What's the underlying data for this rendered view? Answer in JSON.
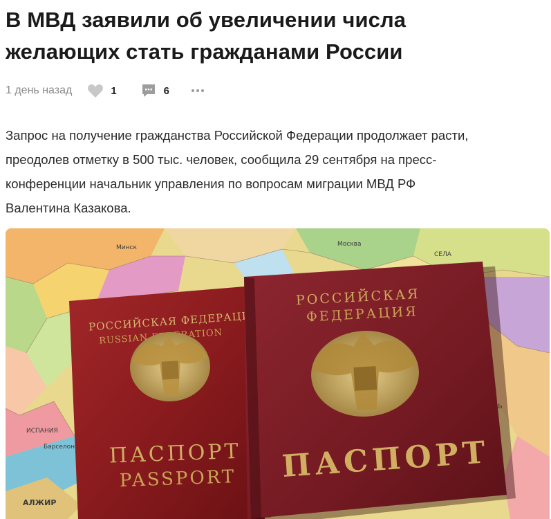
{
  "article": {
    "title_lines": [
      "В МВД заявили об увеличении числа",
      "желающих стать гражданами России"
    ],
    "meta": {
      "time": "1 день назад",
      "likes": "1",
      "comments": "6",
      "icons": {
        "like": "heart-icon",
        "comments": "comment-icon",
        "more": "more-dots-icon"
      }
    },
    "lead_lines": [
      "Запрос на получение гражданства Российской Федерации продолжает расти,",
      "преодолев отметку в 500 тыс. человек, сообщила 29 сентября на пресс-",
      "конференции начальник управления по вопросам миграции МВД РФ",
      "Валентина Казакова."
    ],
    "image": {
      "left_passport": {
        "top_line1": "РОССИЙСКАЯ ФЕДЕРАЦИЯ",
        "top_line2": "RUSSIAN FEDERATION",
        "bottom_line1": "ПАСПОРТ",
        "bottom_line2": "PASSPORT"
      },
      "right_passport": {
        "top_line1": "РОССИЙСКАЯ",
        "top_line2": "ФЕДЕРАЦИЯ",
        "bottom": "ПАСПОРТ"
      },
      "map_labels": [
        "АЛЖИР",
        "Барселона",
        "ИСПАНИЯ"
      ],
      "colors": {
        "passport_left": "#8e1c1f",
        "passport_right": "#7a1d22",
        "gold": "#c9a455"
      }
    }
  }
}
